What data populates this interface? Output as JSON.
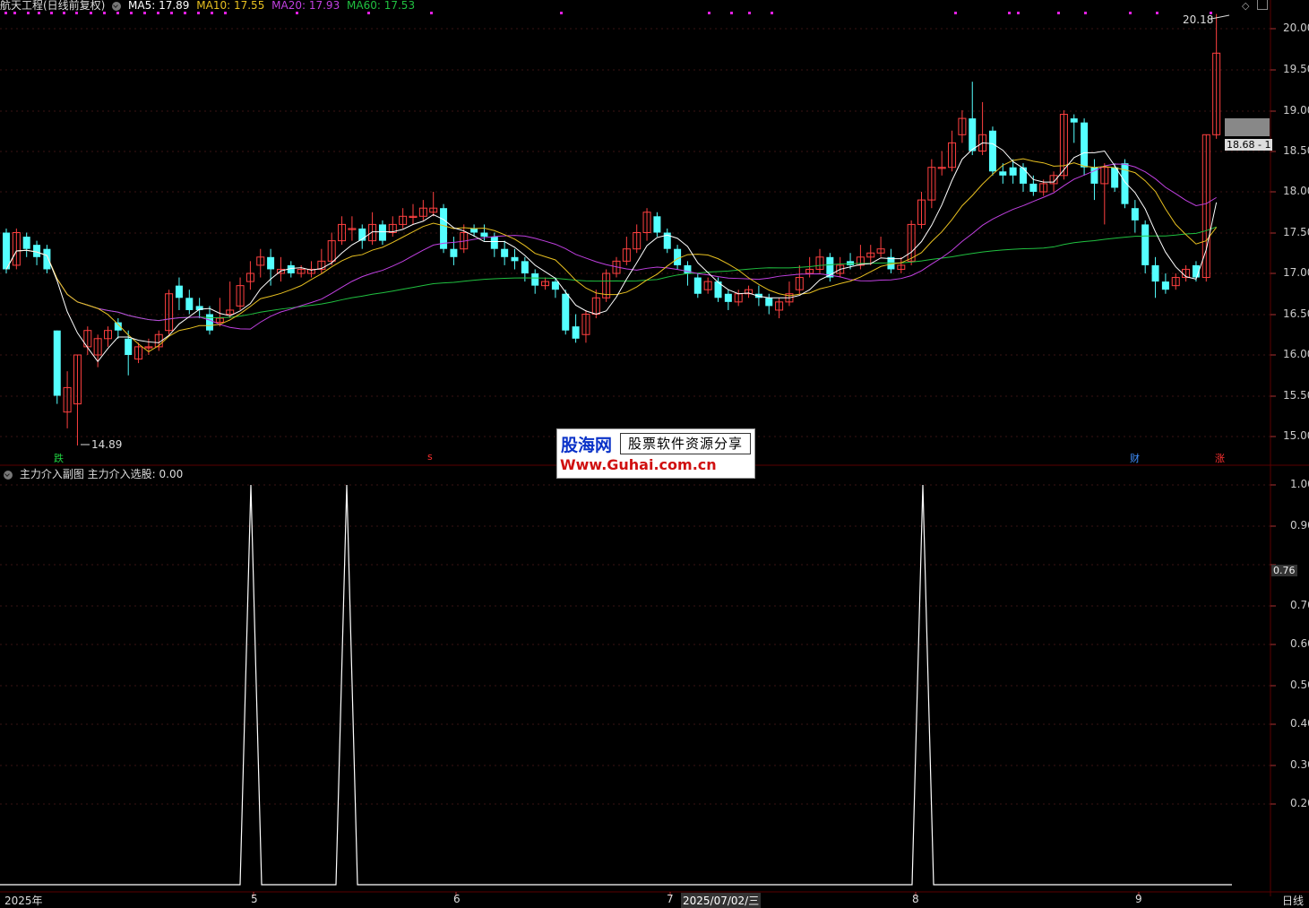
{
  "header": {
    "stock_title": "航天工程(日线前复权)",
    "ma5": "MA5: 17.89",
    "ma10": "MA10: 17.55",
    "ma20": "MA20: 17.93",
    "ma60": "MA60: 17.53",
    "colors": {
      "ma5": "#ffffff",
      "ma10": "#e8c020",
      "ma20": "#c040e0",
      "ma60": "#20c040"
    }
  },
  "main_axis": {
    "ticks": [
      "20.00",
      "19.50",
      "19.00",
      "18.50",
      "18.00",
      "17.50",
      "17.00",
      "16.50",
      "16.00",
      "15.50",
      "15.00"
    ],
    "price_tag": "18.68 - 1",
    "high_label": "20.18",
    "low_label": "14.89"
  },
  "markers": {
    "die": "跌",
    "s": "s",
    "cai": "财",
    "zhang": "涨"
  },
  "sub": {
    "title": "主力介入副图",
    "value_label": "主力介入选股: 0.00",
    "ticks": [
      "1.00",
      "0.90",
      "0.70",
      "0.60",
      "0.50",
      "0.40",
      "0.30",
      "0.20"
    ],
    "current": "0.76",
    "spikes": [
      {
        "x_label": "spike-1",
        "value": 1.0
      },
      {
        "x_label": "spike-2",
        "value": 1.0
      },
      {
        "x_label": "spike-3",
        "value": 1.0
      }
    ]
  },
  "x_axis": {
    "labels": [
      "2025年",
      "5",
      "6",
      "7",
      "8",
      "9"
    ],
    "cursor_date": "2025/07/02/三",
    "period": "日线"
  },
  "logo": {
    "name": "股海网",
    "slogan": "股票软件资源分享",
    "url": "Www.Guhai.com.cn"
  },
  "colors": {
    "up": "#ff4040",
    "down": "#54ffff",
    "grid": "#2a2a2a",
    "sep": "#3a0000"
  }
}
